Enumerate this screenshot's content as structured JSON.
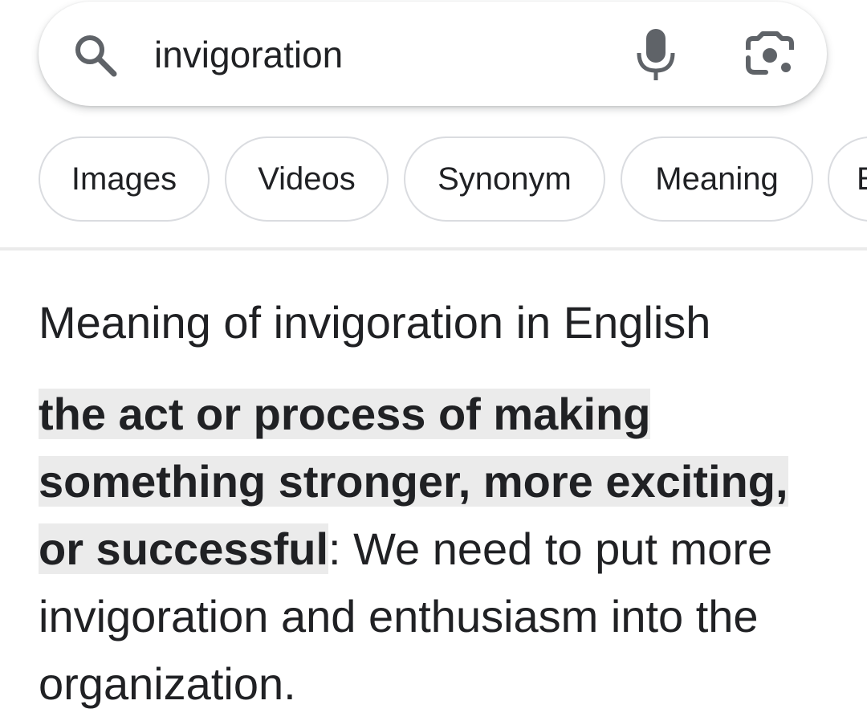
{
  "search": {
    "query": "invigoration",
    "icons": {
      "search": "search-icon",
      "mic": "mic-icon",
      "lens": "camera-lens-icon"
    }
  },
  "chips": [
    "Images",
    "Videos",
    "Synonym",
    "Meaning",
    "E"
  ],
  "result": {
    "heading": "Meaning of invigoration in English",
    "definition": "the act or process of making something stronger, more exciting, or successful",
    "separator": ": ",
    "example": "We need to put more invigoration and enthusiasm into the organization."
  },
  "colors": {
    "text": "#202124",
    "icon": "#5f6368",
    "chip_border": "#dadce0",
    "highlight": "#ebebeb"
  }
}
